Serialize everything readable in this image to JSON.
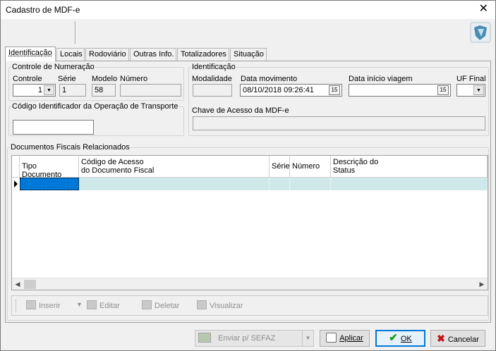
{
  "window": {
    "title": "Cadastro de MDF-e",
    "close_glyph": "✕"
  },
  "tabs": [
    {
      "label": "Identificação",
      "active": true
    },
    {
      "label": "Locais"
    },
    {
      "label": "Rodoviário"
    },
    {
      "label": "Outras Info."
    },
    {
      "label": "Totalizadores"
    },
    {
      "label": "Situação"
    }
  ],
  "numeracao": {
    "legend": "Controle de Numeração",
    "controle_label": "Controle",
    "controle_value": "1",
    "serie_label": "Série",
    "serie_value": "1",
    "modelo_label": "Modelo",
    "modelo_value": "58",
    "numero_label": "Número",
    "numero_value": ""
  },
  "identificacao": {
    "legend": "Identificação",
    "modalidade_label": "Modalidade",
    "modalidade_value": "",
    "data_movimento_label": "Data movimento",
    "data_movimento_value": "08/10/2018 09:26:41",
    "data_inicio_label": "Data início viagem",
    "data_inicio_value": "",
    "uf_final_label": "UF Final",
    "uf_final_value": "",
    "chave_label": "Chave de Acesso da MDF-e",
    "chave_value": ""
  },
  "ciot": {
    "legend": "Código Identificador da Operação de Transporte",
    "value": ""
  },
  "documentos": {
    "legend": "Documentos Fiscais Relacionados",
    "columns": [
      "Tipo Documento",
      "Código de Acesso\ndo Documento Fiscal",
      "Série",
      "Número",
      "Descrição do\nStatus"
    ],
    "actions": [
      "Inserir",
      "Editar",
      "Deletar",
      "Visualizar"
    ]
  },
  "footer": {
    "enviar_label": "Enviar p/ SEFAZ",
    "aplicar_label": "Aplicar",
    "ok_label": "OK",
    "cancelar_label": "Cancelar"
  },
  "icons": {
    "calendar": "calendar-icon",
    "logo": "app-logo-icon",
    "ok": "check-icon",
    "cancel": "x-icon",
    "apply": "apply-icon",
    "send": "send-icon"
  }
}
